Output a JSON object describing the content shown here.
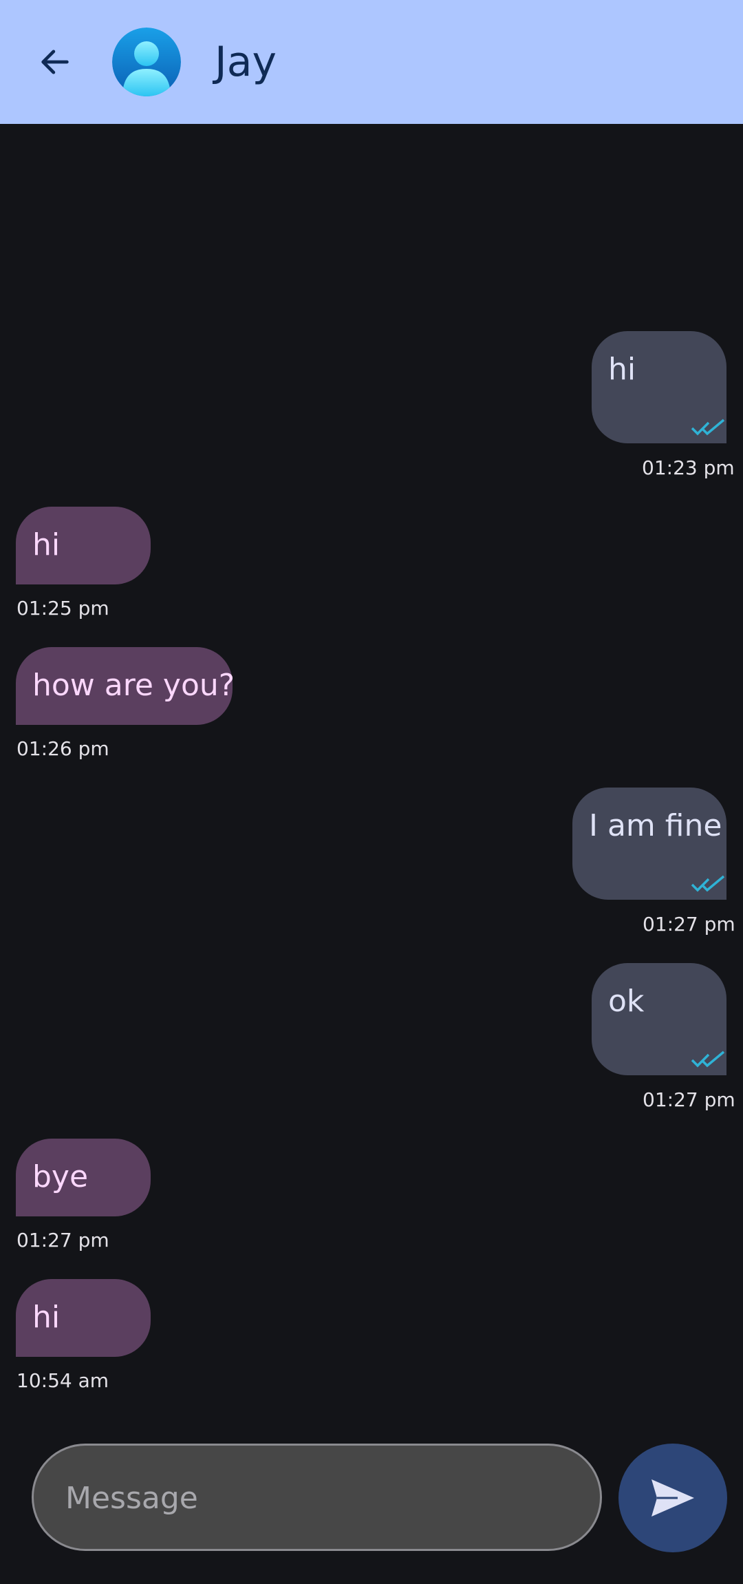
{
  "header": {
    "contact_name": "Jay",
    "back_icon": "arrow-left-icon",
    "avatar_icon": "person-icon"
  },
  "messages": [
    {
      "direction": "outgoing",
      "text": "hi",
      "time": "01:23 pm",
      "status": "read"
    },
    {
      "direction": "incoming",
      "text": "hi",
      "time": "01:25 pm"
    },
    {
      "direction": "incoming",
      "text": "how are you?",
      "time": "01:26 pm"
    },
    {
      "direction": "outgoing",
      "text": "I am fine",
      "time": "01:27 pm",
      "status": "read"
    },
    {
      "direction": "outgoing",
      "text": "ok",
      "time": "01:27 pm",
      "status": "read"
    },
    {
      "direction": "incoming",
      "text": "bye",
      "time": "01:27 pm"
    },
    {
      "direction": "incoming",
      "text": "hi",
      "time": "10:54 am"
    }
  ],
  "composer": {
    "placeholder": "Message",
    "value": "",
    "send_icon": "send-icon"
  },
  "colors": {
    "appbar": "#adc6ff",
    "background": "#131418",
    "outgoing_bubble": "#434758",
    "incoming_bubble": "#5b3f5f",
    "read_tick": "#2fb3d6",
    "send_button": "#2d4678"
  }
}
